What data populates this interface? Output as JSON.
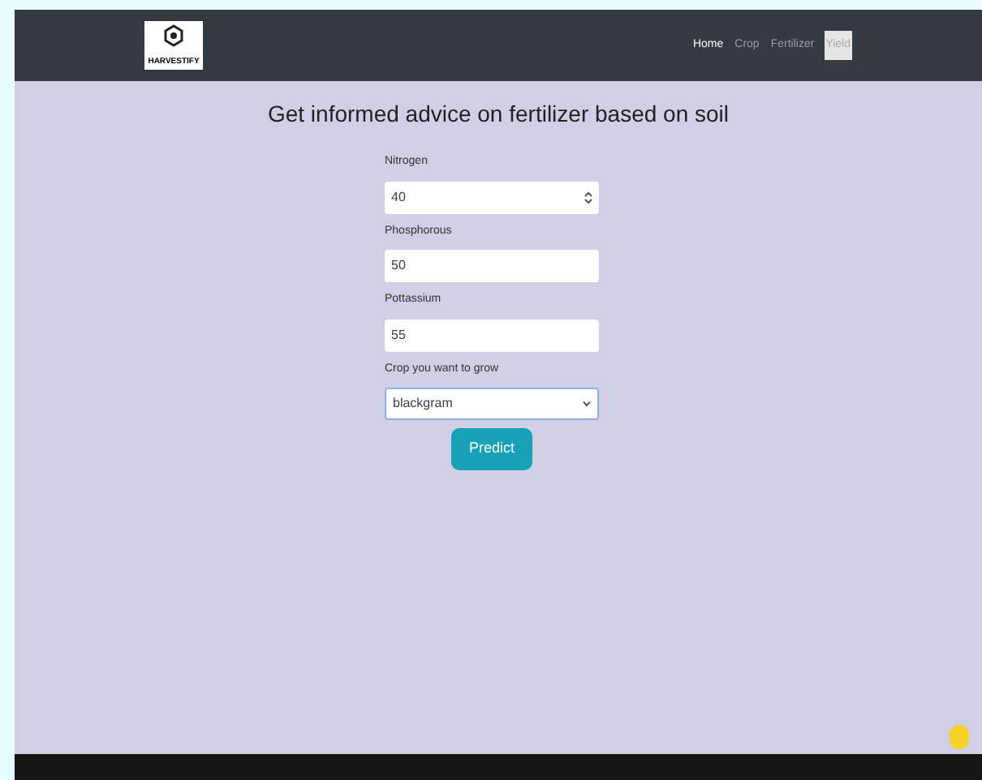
{
  "brand": {
    "name": "HARVESTIFY"
  },
  "nav": [
    {
      "label": "Home",
      "selected": true,
      "highlighted": false
    },
    {
      "label": "Crop",
      "selected": false,
      "highlighted": false
    },
    {
      "label": "Fertilizer",
      "selected": false,
      "highlighted": false
    },
    {
      "label": "Yield",
      "selected": false,
      "highlighted": true
    }
  ],
  "heading": "Get informed advice on fertilizer based on soil",
  "fields": [
    {
      "label": "Nitrogen",
      "value": "40",
      "kind": "number"
    },
    {
      "label": "Phosphorous",
      "value": "50",
      "kind": "text"
    },
    {
      "label": "Pottassium",
      "value": "55",
      "kind": "text"
    },
    {
      "label": "Crop you want to grow",
      "value": "blackgram",
      "kind": "select"
    }
  ],
  "submit": "Predict"
}
